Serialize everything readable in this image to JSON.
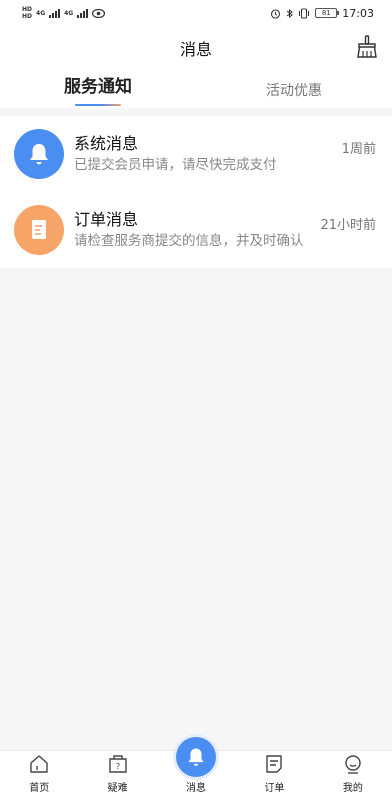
{
  "status_bar": {
    "hd1": "HD",
    "hd2": "HD",
    "net1": "4G",
    "net2": "4G",
    "battery": "81",
    "time": "17:03"
  },
  "header": {
    "title": "消息",
    "clean_icon": "broom-clean-icon"
  },
  "tabs": [
    {
      "label": "服务通知",
      "active": true
    },
    {
      "label": "活动优惠",
      "active": false
    }
  ],
  "messages": [
    {
      "title": "系统消息",
      "subtitle": "已提交会员申请，请尽快完成支付",
      "time": "1周前",
      "icon": "bell-icon",
      "color": "#4b8ef2"
    },
    {
      "title": "订单消息",
      "subtitle": "请检查服务商提交的信息，并及时确认",
      "time": "21小时前",
      "icon": "document-icon",
      "color": "#f6a468"
    }
  ],
  "bottom_nav": [
    {
      "label": "首页",
      "icon": "home-icon"
    },
    {
      "label": "疑难",
      "icon": "question-box-icon"
    },
    {
      "label": "消息",
      "icon": "bell-icon",
      "active": true
    },
    {
      "label": "订单",
      "icon": "order-icon"
    },
    {
      "label": "我的",
      "icon": "profile-icon"
    }
  ],
  "colors": {
    "accent_blue": "#4b8ef2",
    "accent_orange": "#f6a468"
  }
}
